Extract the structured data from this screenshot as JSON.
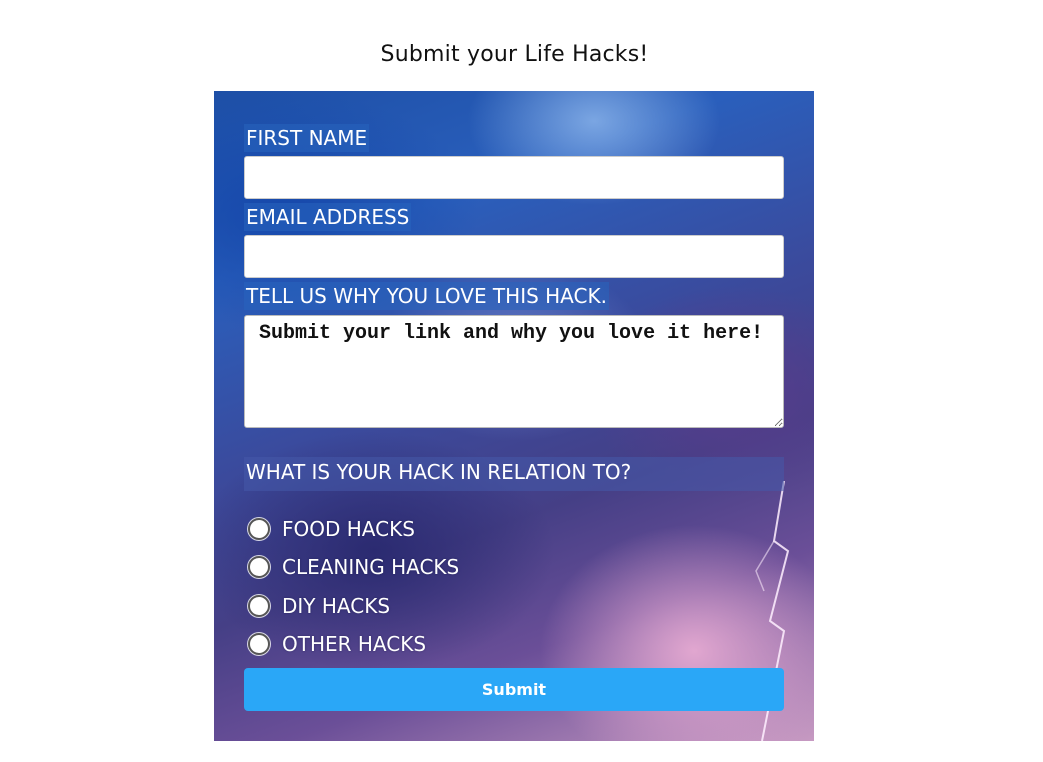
{
  "page": {
    "title": "Submit your Life Hacks!"
  },
  "form": {
    "first_name_label": "FIRST NAME",
    "first_name_value": "",
    "email_label": "EMAIL ADDRESS",
    "email_value": "",
    "message_label": "TELL US WHY YOU LOVE THIS HACK.",
    "message_placeholder": "Submit your link and why you love it here!",
    "category_question": "WHAT IS YOUR HACK IN RELATION TO?",
    "categories": [
      {
        "label": "FOOD HACKS",
        "selected": false
      },
      {
        "label": "CLEANING HACKS",
        "selected": false
      },
      {
        "label": "DIY HACKS",
        "selected": false
      },
      {
        "label": "OTHER HACKS",
        "selected": false
      }
    ],
    "submit_label": "Submit"
  },
  "colors": {
    "submit_button": "#2aa7f7",
    "label_text": "#ffffff",
    "panel_background_theme": "stormy sky"
  }
}
